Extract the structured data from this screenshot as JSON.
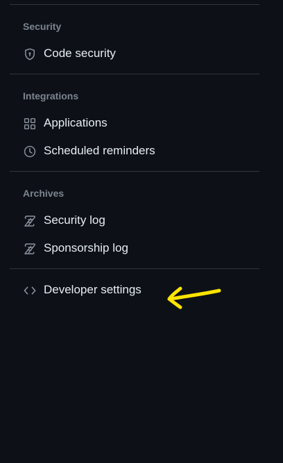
{
  "sections": {
    "security": {
      "heading": "Security",
      "items": [
        {
          "label": "Code security",
          "icon": "shield-lock-icon"
        }
      ]
    },
    "integrations": {
      "heading": "Integrations",
      "items": [
        {
          "label": "Applications",
          "icon": "apps-icon"
        },
        {
          "label": "Scheduled reminders",
          "icon": "clock-icon"
        }
      ]
    },
    "archives": {
      "heading": "Archives",
      "items": [
        {
          "label": "Security log",
          "icon": "log-icon"
        },
        {
          "label": "Sponsorship log",
          "icon": "log-icon"
        }
      ]
    },
    "developer": {
      "items": [
        {
          "label": "Developer settings",
          "icon": "code-icon"
        }
      ]
    }
  },
  "annotation": {
    "icon": "arrow-annotation-icon",
    "color": "#ffe400"
  },
  "colors": {
    "background": "#0d1117",
    "text": "#e6edf3",
    "muted": "#7d8590",
    "border": "#30363d"
  }
}
